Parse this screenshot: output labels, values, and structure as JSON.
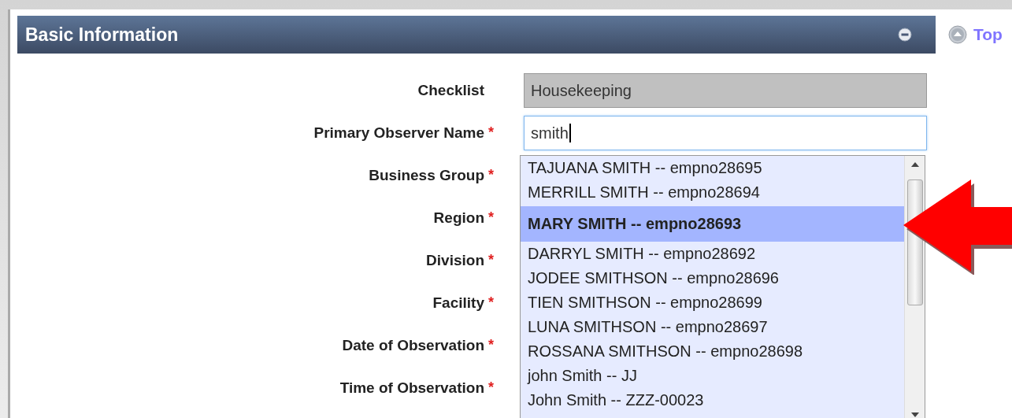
{
  "section": {
    "title": "Basic Information"
  },
  "top_link": {
    "label": "Top"
  },
  "fields": [
    {
      "label": "Checklist",
      "kind": "readonly",
      "value": "Housekeeping"
    },
    {
      "label": "Primary Observer Name",
      "required_mark": "*",
      "kind": "text",
      "value": "smith",
      "focused": true
    },
    {
      "label": "Business Group",
      "required_mark": "*",
      "kind": "hidden"
    },
    {
      "label": "Region",
      "required_mark": "*",
      "kind": "hidden"
    },
    {
      "label": "Division",
      "required_mark": "*",
      "kind": "hidden"
    },
    {
      "label": "Facility",
      "required_mark": "*",
      "kind": "hidden"
    },
    {
      "label": "Date of Observation",
      "required_mark": "*",
      "kind": "hidden"
    },
    {
      "label": "Time of Observation",
      "required_mark": "*",
      "kind": "hidden"
    }
  ],
  "autocomplete": {
    "items": [
      {
        "label": "TAJUANA SMITH -- empno28695",
        "selected": false
      },
      {
        "label": "MERRILL SMITH -- empno28694",
        "selected": false
      },
      {
        "label": "MARY SMITH -- empno28693",
        "selected": true
      },
      {
        "label": "DARRYL SMITH -- empno28692",
        "selected": false
      },
      {
        "label": "JODEE SMITHSON -- empno28696",
        "selected": false
      },
      {
        "label": "TIEN SMITHSON -- empno28699",
        "selected": false
      },
      {
        "label": "LUNA SMITHSON -- empno28697",
        "selected": false
      },
      {
        "label": "ROSSANA SMITHSON -- empno28698",
        "selected": false
      },
      {
        "label": "john Smith -- JJ",
        "selected": false
      },
      {
        "label": "John Smith -- ZZZ-00023",
        "selected": false
      }
    ]
  }
}
